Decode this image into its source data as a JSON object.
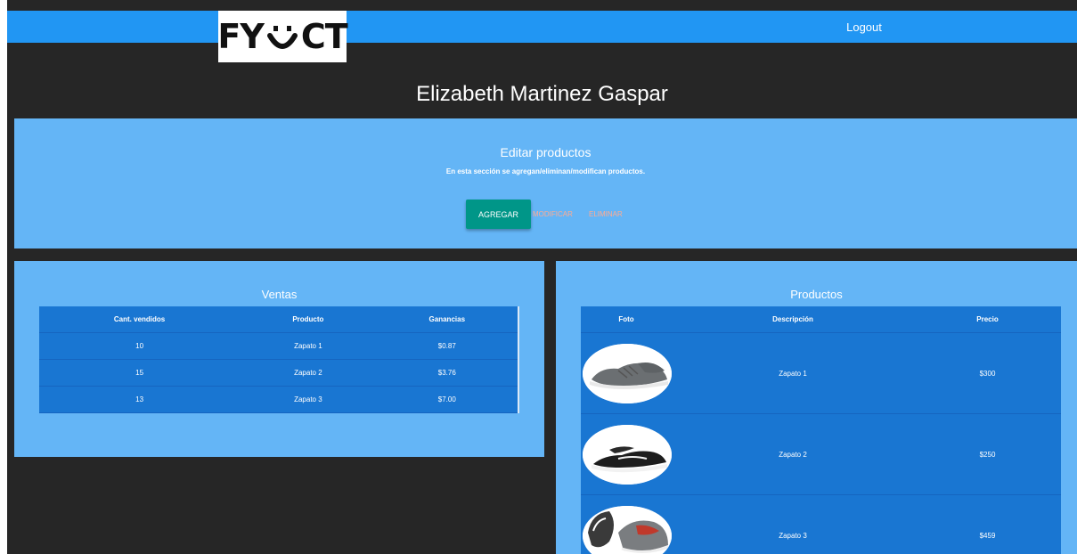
{
  "navbar": {
    "logo_text_left": "FY",
    "logo_text_right": "CT",
    "logout_label": "Logout",
    "color": "#2196f3"
  },
  "user": {
    "name": "Elizabeth Martinez Gaspar"
  },
  "edit_section": {
    "title": "Editar productos",
    "description": "En esta sección se agregan/eliminan/modifican productos.",
    "add_label": "AGREGAR",
    "modify_label": "MODIFICAR",
    "delete_label": "ELIMINAR"
  },
  "ventas": {
    "title": "Ventas",
    "headers": [
      "Cant. vendidos",
      "Producto",
      "Ganancias"
    ],
    "rows": [
      [
        "10",
        "Zapato 1",
        "$0.87"
      ],
      [
        "15",
        "Zapato 2",
        "$3.76"
      ],
      [
        "13",
        "Zapato 3",
        "$7.00"
      ]
    ]
  },
  "productos": {
    "title": "Productos",
    "headers": [
      "Foto",
      "Descripción",
      "Precio"
    ],
    "rows": [
      {
        "photo_icon": "gray-sneaker-image",
        "description": "Zapato 1",
        "price": "$300"
      },
      {
        "photo_icon": "black-sneaker-image",
        "description": "Zapato 2",
        "price": "$250"
      },
      {
        "photo_icon": "red-gray-sneaker-image",
        "description": "Zapato 3",
        "price": "$459"
      }
    ]
  },
  "colors": {
    "background": "#262626",
    "panel": "#64b5f6",
    "table": "#1976d2",
    "add_button": "#009688",
    "link_buttons": "#ffab91"
  }
}
